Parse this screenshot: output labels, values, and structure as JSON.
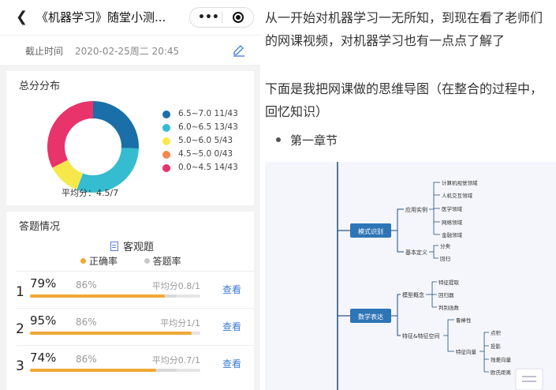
{
  "header": {
    "title": "《机器学习》随堂小测...",
    "back_icon": "chevron-left-icon",
    "more_icon": "more-dots-icon",
    "target_icon": "target-icon"
  },
  "deadline": {
    "label": "截止时间",
    "value": "2020-02-25周二 20:45",
    "icon": "edit-icon"
  },
  "distribution": {
    "title": "总分分布",
    "average": "平均分：4.5/7",
    "chart_data": {
      "type": "pie",
      "categories": [
        "6.5~7.0",
        "6.0~6.5",
        "5.0~6.0",
        "4.5~5.0",
        "0.0~4.5"
      ],
      "values": [
        11,
        13,
        5,
        0,
        14
      ],
      "colors": [
        "#1a6fa8",
        "#35bcd0",
        "#f6e84a",
        "#f2884a",
        "#e8336b"
      ],
      "legend_labels": [
        "6.5~7.0 11/43",
        "6.0~6.5 13/43",
        "5.0~6.0 5/43",
        "4.5~5.0 0/43",
        "0.0~4.5 14/43"
      ]
    }
  },
  "answers": {
    "title": "答题情况",
    "type_label": "客观题",
    "legend_correct": "正确率",
    "legend_answered": "答题率",
    "correct_color": "#f0a833",
    "answered_color": "#c8c8c8",
    "rows": [
      {
        "num": "1",
        "correct": "79%",
        "answered": "86%",
        "avg": "平均分0.8/1",
        "action": "查看",
        "correct_val": 0.79,
        "answered_val": 0.86
      },
      {
        "num": "2",
        "correct": "95%",
        "answered": "86%",
        "avg": "平均分1/1",
        "action": "查看",
        "correct_val": 0.95,
        "answered_val": 0.86
      },
      {
        "num": "3",
        "correct": "74%",
        "answered": "86%",
        "avg": "平均分0.7/1",
        "action": "查看",
        "correct_val": 0.74,
        "answered_val": 0.86
      }
    ]
  },
  "article": {
    "para1": "从一开始对机器学习一无所知，到现在看了老师们的网课视频，对机器学习也有一点点了解了",
    "para2": "下面是我把网课做的思维导图（在整合的过程中，回忆知识）",
    "bullet": "第一章节"
  },
  "mindmap": {
    "node1": "模式识别",
    "node1_children": [
      "应用实例",
      "基本定义"
    ],
    "apps": [
      "计算机视觉领域",
      "人机交互领域",
      "医学领域",
      "网络领域",
      "金融领域"
    ],
    "defs": [
      "分类",
      "回归"
    ],
    "node2": "数学表达",
    "node2_children": [
      "模型概念",
      "特征&特征空间"
    ],
    "model": [
      "特征提取",
      "回归器",
      "判别函数"
    ],
    "feature": [
      "鲁棒性",
      "特征向量"
    ],
    "vector": [
      "点积",
      "投影",
      "残差向量",
      "欧氏距离"
    ]
  }
}
